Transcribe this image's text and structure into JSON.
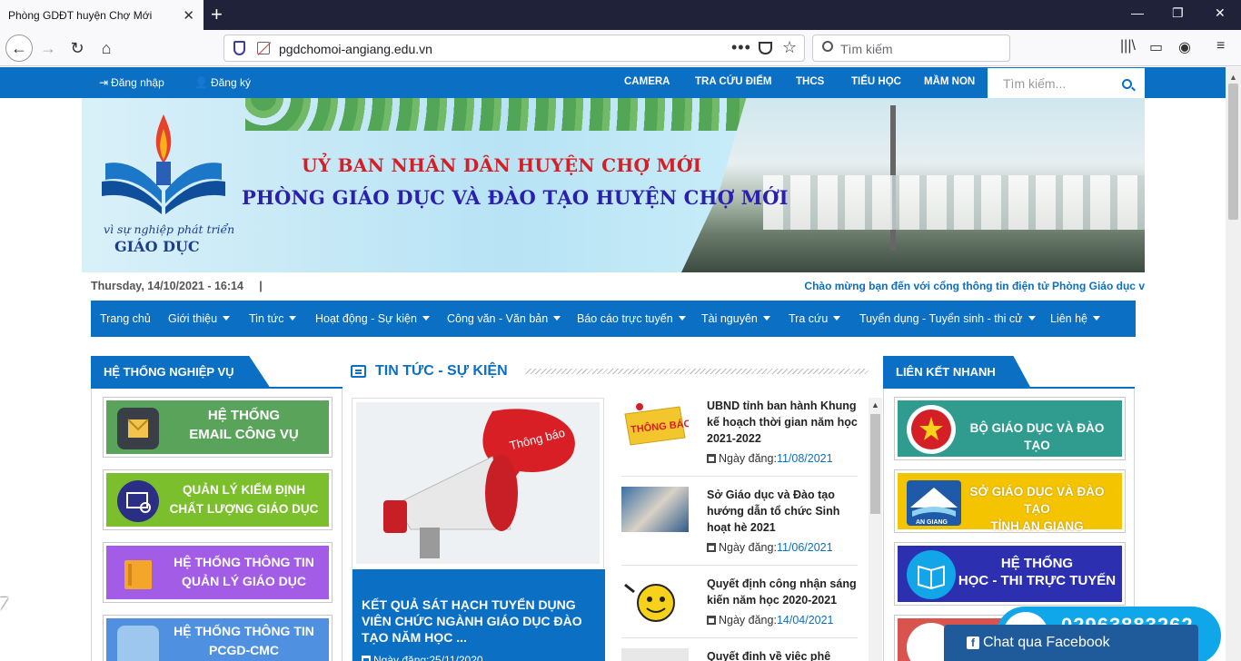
{
  "browser": {
    "tab_title": "Phòng GDĐT huyện Chợ Mới",
    "url": "pgdchomoi-angiang.edu.vn",
    "search_placeholder": "Tìm kiếm"
  },
  "topbar": {
    "login": "Đăng nhập",
    "register": "Đăng ký",
    "nav": [
      "CAMERA",
      "TRA CỨU ĐIỂM",
      "THCS",
      "TIỂU HỌC",
      "MẦM NON"
    ],
    "search_placeholder": "Tìm kiếm..."
  },
  "banner": {
    "logo_line1": "vì sự nghiệp phát triển",
    "logo_line2": "GIÁO DỤC",
    "title1": "UỶ BAN NHÂN DÂN HUYỆN CHỢ MỚI",
    "title2": "PHÒNG GIÁO DỤC VÀ ĐÀO TẠO HUYỆN CHỢ MỚI"
  },
  "datebar": {
    "date": "Thursday, 14/10/2021 - 16:14",
    "separator": "|",
    "welcome": "Chào mừng bạn đến với cổng thông tin điện tử Phòng Giáo dục v"
  },
  "mainnav": [
    "Trang chủ",
    "Giới thiệu",
    "Tin tức",
    "Hoạt động - Sự kiện",
    "Công văn - Văn bản",
    "Báo cáo trực tuyến",
    "Tài nguyên",
    "Tra cứu",
    "Tuyển dụng - Tuyển sinh - thi cử",
    "Liên hệ"
  ],
  "left": {
    "heading": "HỆ THỐNG NGHIỆP VỤ",
    "buttons": [
      {
        "line1": "HỆ THỐNG",
        "line2": "EMAIL CÔNG VỤ",
        "color": "#5aa35a"
      },
      {
        "line1": "QUẢN LÝ KIỂM ĐỊNH",
        "line2": "CHẤT LƯỢNG GIÁO DỤC",
        "color": "#7cbf2c"
      },
      {
        "line1": "HỆ THỐNG THÔNG TIN",
        "line2": "QUẢN LÝ GIÁO DỤC",
        "color": "#a35ce6"
      },
      {
        "line1": "HỆ THỐNG THÔNG TIN",
        "line2": "PCGD-CMC",
        "color": "#4f90e0"
      }
    ]
  },
  "center": {
    "heading": "TIN TỨC - SỰ KIỆN",
    "feature": {
      "bubble": "Thông báo",
      "title": "KẾT QUẢ SÁT HẠCH TUYỂN DỤNG VIÊN CHỨC NGÀNH GIÁO DỤC ĐÀO TẠO NĂM HỌC ...",
      "date": "Ngày đăng:25/11/2020"
    },
    "date_label": "Ngày đăng:",
    "news": [
      {
        "title": "UBND tỉnh ban hành Khung kế hoạch thời gian năm học 2021-2022",
        "date": "11/08/2021",
        "thumb_text": "THÔNG BÁO"
      },
      {
        "title": "Sở Giáo dục và Đào tạo hướng dẫn tổ chức Sinh hoạt hè 2021",
        "date": "11/06/2021"
      },
      {
        "title": "Quyết định công nhận sáng kiến năm học 2020-2021",
        "date": "14/04/2021"
      },
      {
        "title": "Quyết định về việc phê duyệt",
        "date": ""
      }
    ]
  },
  "right": {
    "heading": "LIÊN KẾT NHANH",
    "links": [
      {
        "line1": "BỘ GIÁO DỤC VÀ ĐÀO TẠO",
        "line2": "",
        "color": "#2f9c8f",
        "text_color": "#ffffff"
      },
      {
        "line1": "SỞ GIÁO DỤC VÀ ĐÀO TẠO",
        "line2": "TỈNH AN GIANG",
        "color": "#f5c400",
        "text_color": "#ffffff",
        "badge": "AN GIANG"
      },
      {
        "line1": "HỆ THỐNG",
        "line2": "HỌC - THI TRỰC TUYẾN",
        "color": "#2b2fb0",
        "text_color": "#ffffff"
      },
      {
        "line1": "",
        "line2": "",
        "color": "#d9544f",
        "text_color": "#ffffff"
      }
    ]
  },
  "hotline": {
    "number": "02963883262"
  },
  "fbchat": {
    "label": "Chat qua Facebook"
  }
}
